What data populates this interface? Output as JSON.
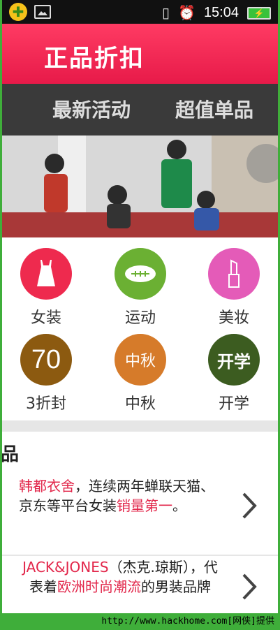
{
  "status_bar": {
    "time": "15:04"
  },
  "header": {
    "title": "正品折扣"
  },
  "tabs": [
    {
      "label": "最新活动"
    },
    {
      "label": "超值单品"
    }
  ],
  "categories": [
    {
      "label": "女装",
      "icon": "dress-icon",
      "color": "#ee2a4e"
    },
    {
      "label": "运动",
      "icon": "football-icon",
      "color": "#6bb033"
    },
    {
      "label": "美妆",
      "icon": "lipstick-icon",
      "color": "#e45bb8"
    },
    {
      "label": "3折封",
      "icon": "seventy-badge-icon",
      "color": "#8c5a10",
      "badge_text": "70"
    },
    {
      "label": "中秋",
      "icon": "mid-autumn-icon",
      "color": "#d67b2a",
      "badge_text": "中秋"
    },
    {
      "label": "开学",
      "icon": "back-to-school-icon",
      "color": "#3c5c20",
      "badge_text": "开学"
    }
  ],
  "section": {
    "heading": "品"
  },
  "items": [
    {
      "brand": "韩都衣舍",
      "text_1": "，连续两年蝉联天猫、京东等平台女装",
      "highlight": "销量第一",
      "text_2": "。"
    },
    {
      "brand": "JACK&JONES",
      "text_1": "（杰克.琼斯），代表着",
      "highlight": "欧洲时尚潮流",
      "text_2": "的男装品牌"
    }
  ],
  "footer": {
    "watermark": "http://www.hackhome.com[网侠]提供"
  }
}
